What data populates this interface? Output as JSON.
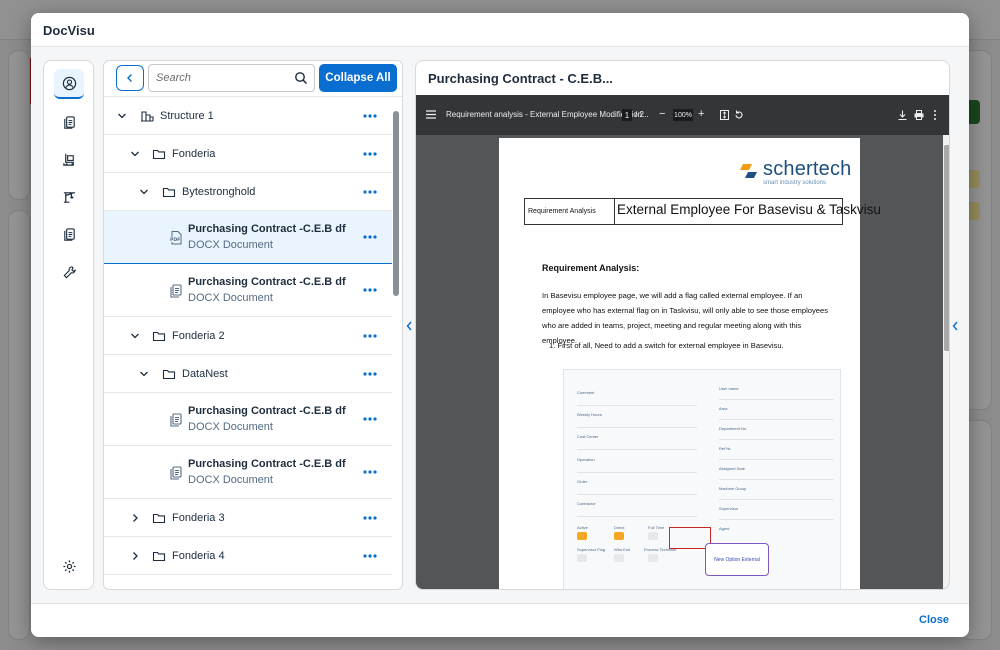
{
  "dialog": {
    "title": "DocVisu",
    "close_label": "Close"
  },
  "rail": {
    "items": [
      {
        "icon": "user-circle-icon",
        "active": true
      },
      {
        "icon": "documents-icon",
        "active": false
      },
      {
        "icon": "machine-icon",
        "active": false
      },
      {
        "icon": "crane-icon",
        "active": false
      },
      {
        "icon": "documents-icon",
        "active": false
      },
      {
        "icon": "wrench-icon",
        "active": false
      }
    ],
    "settings_icon": "gear-icon"
  },
  "tree": {
    "search_placeholder": "Search",
    "collapse_label": "Collapse All",
    "rows": [
      {
        "label": "Structure 1",
        "kind": "structure",
        "expanded": true
      },
      {
        "label": "Fonderia",
        "kind": "folder",
        "expanded": true
      },
      {
        "label": "Bytestronghold",
        "kind": "folder",
        "expanded": true
      },
      {
        "label": "Purchasing Contract -C.E.B df",
        "sub": "DOCX Document",
        "kind": "pdf",
        "selected": true
      },
      {
        "label": "Purchasing Contract -C.E.B df",
        "sub": "DOCX Document",
        "kind": "doc"
      },
      {
        "label": "Fonderia 2",
        "kind": "folder",
        "expanded": true
      },
      {
        "label": "DataNest",
        "kind": "folder",
        "expanded": true
      },
      {
        "label": "Purchasing Contract -C.E.B df",
        "sub": "DOCX Document",
        "kind": "doc"
      },
      {
        "label": "Purchasing Contract -C.E.B df",
        "sub": "DOCX Document",
        "kind": "doc"
      },
      {
        "label": "Fonderia 3",
        "kind": "folder",
        "expanded": false
      },
      {
        "label": "Fonderia 4",
        "kind": "folder",
        "expanded": false
      }
    ]
  },
  "preview": {
    "title": "Purchasing Contract - C.E.B...",
    "viewer": {
      "doc_name": "Requirement analysis - External Employee Modification...",
      "page": "1",
      "page_total": "/ 2",
      "zoom": "100%"
    },
    "page": {
      "logo": "schertech",
      "logo_sub": "smart industry solutions",
      "table_left": "Requirement Analysis",
      "table_right": "External Employee For Basevisu & Taskvisu",
      "heading": "Requirement Analysis:",
      "paragraph": "In Basevisu employee page, we will add a flag called external employee. If an employee who has external flag on in Taskvisu, will only able to see those employees who are added in teams, project, meeting and regular meeting along with this employee.",
      "list_item": "1.   First of all, Need to add a switch for external employee in Basevisu.",
      "shot_fields_left": [
        "Comment",
        "Weekly Hours",
        "Cost Center",
        "Operation",
        "Order",
        "Contractor",
        "Active",
        "Direct",
        "Full Time",
        "Supervisor Flag",
        "Whs Exit",
        "Process Techniker"
      ],
      "shot_fields_right": [
        "User name",
        "Area",
        "Department No.",
        "Ref Nr.",
        "Assigned Note",
        "Machine Group",
        "Supervisor",
        "Agent"
      ],
      "callout": "New Option External"
    }
  },
  "colors": {
    "accent": "#0a6ed1",
    "selected_row": "#eaf4ff",
    "pdf_toolbar": "#323639",
    "pdf_bg": "#525659"
  }
}
